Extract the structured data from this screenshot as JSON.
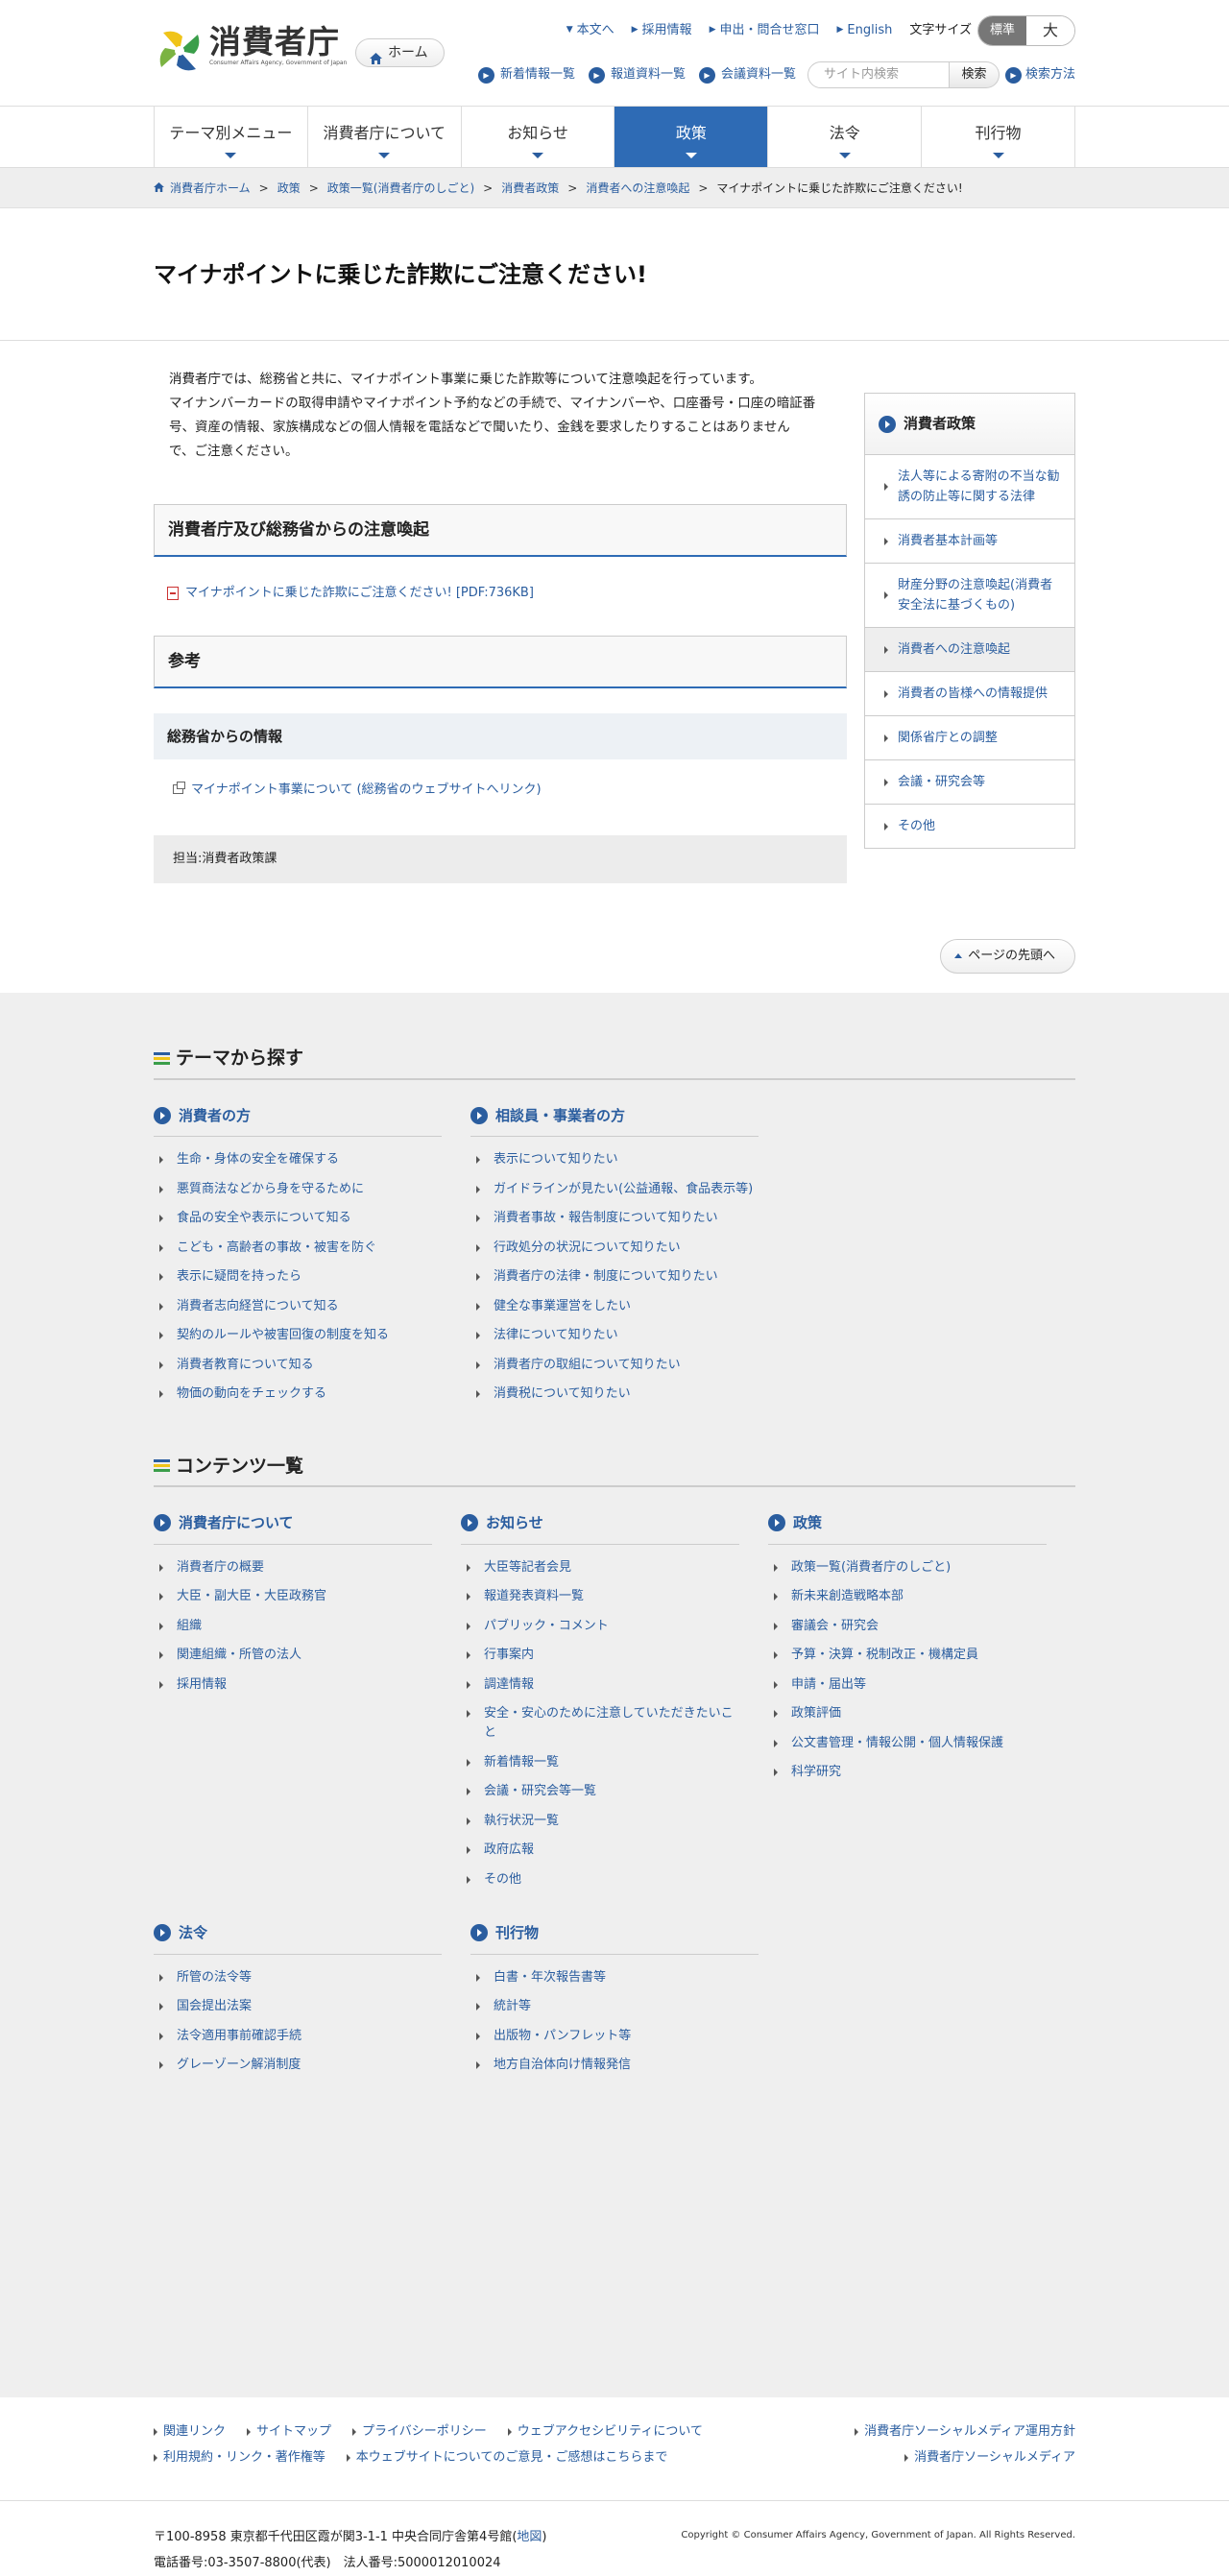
{
  "header": {
    "logo_text": "消費者庁",
    "logo_en": "Consumer Affairs Agency, Government of Japan",
    "home_label": "ホーム",
    "top_links": [
      "本文へ",
      "採用情報",
      "申出・問合せ窓口",
      "English"
    ],
    "font_size_label": "文字サイズ",
    "font_size_standard": "標準",
    "font_size_large": "大",
    "sub_links": [
      "新着情報一覧",
      "報道資料一覧",
      "会議資料一覧"
    ],
    "search_placeholder": "サイト内検索",
    "search_button": "検索",
    "search_help": "検索方法"
  },
  "nav": {
    "items": [
      "テーマ別メニュー",
      "消費者庁について",
      "お知らせ",
      "政策",
      "法令",
      "刊行物"
    ],
    "active": "政策"
  },
  "breadcrumb": [
    "消費者庁ホーム",
    "政策",
    "政策一覧(消費者庁のしごと)",
    "消費者政策",
    "消費者への注意喚起",
    "マイナポイントに乗じた詐欺にご注意ください!"
  ],
  "page_title": "マイナポイントに乗じた詐欺にご注意ください!",
  "content": {
    "intro_lines": [
      "消費者庁では、総務省と共に、マイナポイント事業に乗じた詐欺等について注意喚起を行っています。",
      "マイナンバーカードの取得申請やマイナポイント予約などの手続で、マイナンバーや、口座番号・口座の暗証番",
      "号、資産の情報、家族構成などの個人情報を電話などで聞いたり、金銭を要求したりすることはありません",
      "で、ご注意ください。"
    ],
    "section1_heading": "消費者庁及び総務省からの注意喚起",
    "pdf_link": "マイナポイントに乗じた詐欺にご注意ください! [PDF:736KB]",
    "section2_heading": "参考",
    "subheading": "総務省からの情報",
    "ext_link": "マイナポイント事業について (総務省のウェブサイトへリンク)",
    "charge": "担当:消費者政策課"
  },
  "sidebar": {
    "title": "消費者政策",
    "items": [
      "法人等による寄附の不当な勧誘の防止等に関する法律",
      "消費者基本計画等",
      "財産分野の注意喚起(消費者安全法に基づくもの)",
      "消費者への注意喚起",
      "消費者の皆様への情報提供",
      "関係省庁との調整",
      "会議・研究会等",
      "その他"
    ],
    "current": "消費者への注意喚起"
  },
  "back_to_top": "ページの先頭へ",
  "theme": {
    "title": "テーマから探す",
    "columns": [
      {
        "heading": "消費者の方",
        "items": [
          "生命・身体の安全を確保する",
          "悪質商法などから身を守るために",
          "食品の安全や表示について知る",
          "こども・高齢者の事故・被害を防ぐ",
          "表示に疑問を持ったら",
          "消費者志向経営について知る",
          "契約のルールや被害回復の制度を知る",
          "消費者教育について知る",
          "物価の動向をチェックする"
        ]
      },
      {
        "heading": "相談員・事業者の方",
        "items": [
          "表示について知りたい",
          "ガイドラインが見たい(公益通報、食品表示等)",
          "消費者事故・報告制度について知りたい",
          "行政処分の状況について知りたい",
          "消費者庁の法律・制度について知りたい",
          "健全な事業運営をしたい",
          "法律について知りたい",
          "消費者庁の取組について知りたい",
          "消費税について知りたい"
        ]
      }
    ]
  },
  "contents": {
    "title": "コンテンツ一覧",
    "columns": [
      {
        "heading": "消費者庁について",
        "items": [
          "消費者庁の概要",
          "大臣・副大臣・大臣政務官",
          "組織",
          "関連組織・所管の法人",
          "採用情報"
        ]
      },
      {
        "heading": "お知らせ",
        "items": [
          "大臣等記者会見",
          "報道発表資料一覧",
          "パブリック・コメント",
          "行事案内",
          "調達情報",
          "安全・安心のために注意していただきたいこと",
          "新着情報一覧",
          "会議・研究会等一覧",
          "執行状況一覧",
          "政府広報",
          "その他"
        ]
      },
      {
        "heading": "政策",
        "items": [
          "政策一覧(消費者庁のしごと)",
          "新未来創造戦略本部",
          "審議会・研究会",
          "予算・決算・税制改正・機構定員",
          "申請・届出等",
          "政策評価",
          "公文書管理・情報公開・個人情報保護",
          "科学研究"
        ]
      },
      {
        "heading": "法令",
        "items": [
          "所管の法令等",
          "国会提出法案",
          "法令適用事前確認手続",
          "グレーゾーン解消制度"
        ]
      },
      {
        "heading": "刊行物",
        "items": [
          "白書・年次報告書等",
          "統計等",
          "出版物・パンフレット等",
          "地方自治体向け情報発信"
        ]
      }
    ]
  },
  "footer": {
    "left_row1": [
      "関連リンク",
      "サイトマップ",
      "プライバシーポリシー",
      "ウェブアクセシビリティについて"
    ],
    "left_row2": [
      "利用規約・リンク・著作権等",
      "本ウェブサイトについてのご意見・ご感想はこちらまで"
    ],
    "right": [
      "消費者庁ソーシャルメディア運用方針",
      "消費者庁ソーシャルメディア"
    ],
    "address_prefix": "〒100-8958 東京都千代田区霞が関3-1-1 中央合同庁舎第4号館(",
    "address_map": "地図",
    "address_suffix": ")",
    "phone": "電話番号:03-3507-8800(代表)　法人番号:5000012010024",
    "copyright": "Copyright © Consumer Affairs Agency, Government of Japan. All Rights Reserved."
  },
  "colors": {
    "accent": "#2e6bb5",
    "link": "#2a5d9f",
    "footer_bg": "#efefef"
  }
}
